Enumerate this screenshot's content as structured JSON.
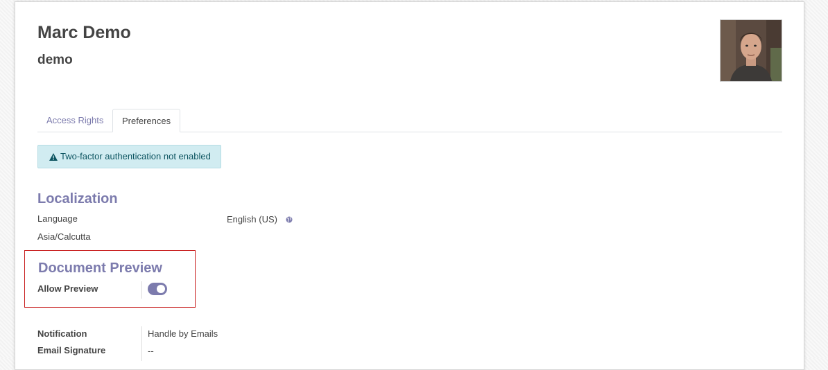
{
  "user": {
    "name": "Marc Demo",
    "login": "demo"
  },
  "tabs": [
    {
      "label": "Access Rights",
      "active": false
    },
    {
      "label": "Preferences",
      "active": true
    }
  ],
  "alert": {
    "text": "Two-factor authentication not enabled",
    "icon": "warning-icon"
  },
  "localization": {
    "title": "Localization",
    "language_label": "Language",
    "language_value": "English (US)",
    "language_icon": "globe-icon",
    "timezone_value": "Asia/Calcutta"
  },
  "document_preview": {
    "title": "Document Preview",
    "allow_preview_label": "Allow Preview",
    "allow_preview_enabled": true
  },
  "notification": {
    "label": "Notification",
    "value": "Handle by Emails"
  },
  "email_signature": {
    "label": "Email Signature",
    "value": "--"
  },
  "colors": {
    "accent": "#7c7bad",
    "alert_bg": "#d1ecf1",
    "alert_text": "#0c5460",
    "highlight_border": "#c81e1e"
  }
}
